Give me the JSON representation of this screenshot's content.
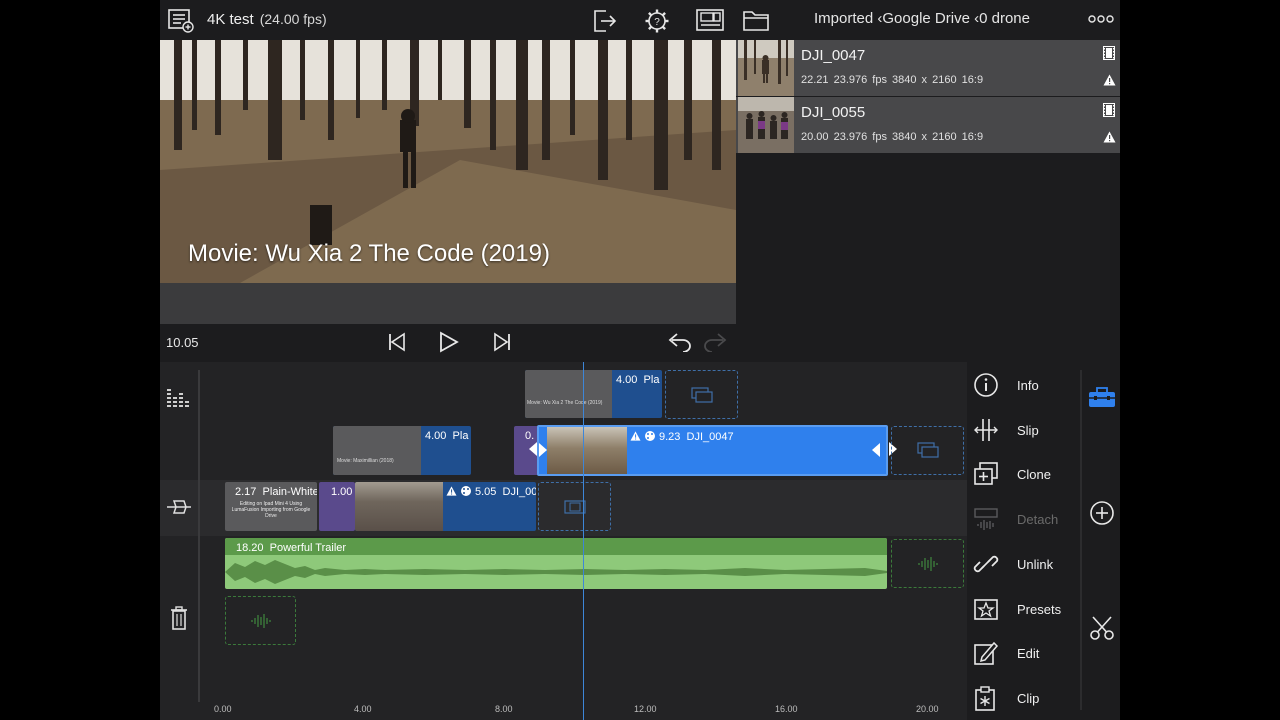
{
  "project": {
    "title": "4K test",
    "fps": "(24.00 fps)"
  },
  "breadcrumb": {
    "imported": "Imported",
    "drive": "Google Drive",
    "folder": "0 drone"
  },
  "viewer": {
    "overlay_text": "Movie: Wu Xia 2 The Code (2019)",
    "timecode": "10.05"
  },
  "media": [
    {
      "name": "DJI_0047",
      "duration": "22.21",
      "fps": "23.976 fps",
      "resolution": "3840 x 2160",
      "aspect": "16:9"
    },
    {
      "name": "DJI_0055",
      "duration": "20.00",
      "fps": "23.976 fps",
      "resolution": "3840 x 2160",
      "aspect": "16:9"
    }
  ],
  "timeline": {
    "title_clip_1": {
      "duration": "4.00",
      "name": "Pla",
      "thumb_text": "Movie: Wu Xia 2 The Code (2019)"
    },
    "title_clip_2": {
      "duration": "4.00",
      "name": "Pla",
      "thumb_text": "Movie: Maximillian (2018)"
    },
    "transition_clip": {
      "duration": "0."
    },
    "selected_clip": {
      "duration": "9.23",
      "name": "DJI_0047"
    },
    "primary_plain": {
      "duration": "2.17",
      "name": "Plain-White",
      "thumb_text": "Editing on Ipad Mini 4 Using LumaFusion Importing from Google Drive"
    },
    "primary_transition": {
      "duration": "1.00"
    },
    "primary_clip": {
      "duration": "5.05",
      "name": "DJI_00"
    },
    "audio_clip": {
      "duration": "18.20",
      "name": "Powerful Trailer"
    },
    "ruler": [
      "0.00",
      "4.00",
      "8.00",
      "12.00",
      "16.00",
      "20.00"
    ]
  },
  "tools": [
    {
      "label": "Info",
      "icon": "info-icon",
      "enabled": true
    },
    {
      "label": "Slip",
      "icon": "slip-icon",
      "enabled": true
    },
    {
      "label": "Clone",
      "icon": "clone-icon",
      "enabled": true
    },
    {
      "label": "Detach",
      "icon": "detach-icon",
      "enabled": false
    },
    {
      "label": "Unlink",
      "icon": "unlink-icon",
      "enabled": true
    },
    {
      "label": "Presets",
      "icon": "presets-icon",
      "enabled": true
    },
    {
      "label": "Edit",
      "icon": "edit-icon",
      "enabled": true
    },
    {
      "label": "Clip",
      "icon": "clip-icon",
      "enabled": true
    }
  ],
  "colors": {
    "accent": "#2f80ed",
    "clip_blue": "#1f4f8f",
    "clip_purple": "#5a4a8c",
    "audio_green": "#8ec97a",
    "audio_header": "#5c9a4a"
  }
}
